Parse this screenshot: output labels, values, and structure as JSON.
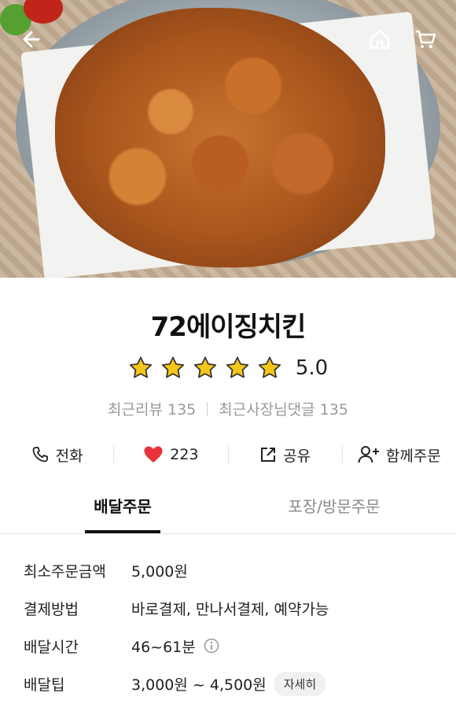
{
  "nav": {
    "back_icon": "back-arrow-icon",
    "home_icon": "home-icon",
    "cart_icon": "cart-icon"
  },
  "store": {
    "name": "72에이징치킨",
    "rating_value": 5.0,
    "rating_text": "5.0",
    "stars_filled": 5,
    "recent_reviews": "최근리뷰 135",
    "owner_replies": "최근사장님댓글 135"
  },
  "actions": [
    {
      "icon": "phone-icon",
      "label": "전화"
    },
    {
      "icon": "heart-icon",
      "label": "223"
    },
    {
      "icon": "share-icon",
      "label": "공유"
    },
    {
      "icon": "add-user-icon",
      "label": "함께주문"
    }
  ],
  "tabs": [
    {
      "label": "배달주문",
      "active": true
    },
    {
      "label": "포장/방문주문",
      "active": false
    }
  ],
  "info": {
    "min_order_label": "최소주문금액",
    "min_order_value": "5,000원",
    "payment_label": "결제방법",
    "payment_value": "바로결제, 만나서결제, 예약가능",
    "time_label": "배달시간",
    "time_value": "46~61분",
    "tip_label": "배달팁",
    "tip_value": "3,000원 ~ 4,500원",
    "tip_more": "자세히"
  },
  "colors": {
    "star": "#f5c518",
    "heart": "#e8333a",
    "accent": "#111111"
  }
}
